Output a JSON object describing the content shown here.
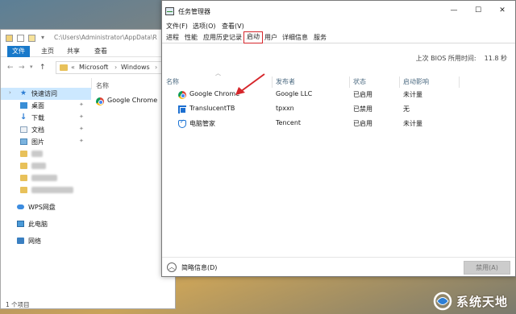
{
  "explorer": {
    "path": "C:\\Users\\Administrator\\AppData\\R",
    "ribbon_tabs": [
      "文件",
      "主页",
      "共享",
      "查看"
    ],
    "breadcrumb": [
      "«",
      "Microsoft",
      "›",
      "Windows",
      "›"
    ],
    "column_name": "名称",
    "files": [
      {
        "name": "Google Chrome",
        "icon": "chrome-icon"
      }
    ],
    "nav": [
      {
        "label": "快速访问",
        "icon": "star-icon",
        "pinned": false
      },
      {
        "label": "桌面",
        "icon": "desktop-icon",
        "pinned": true
      },
      {
        "label": "下载",
        "icon": "download-icon",
        "pinned": true
      },
      {
        "label": "文档",
        "icon": "document-icon",
        "pinned": true
      },
      {
        "label": "图片",
        "icon": "pictures-icon",
        "pinned": true
      },
      {
        "label": "",
        "icon": "folder-icon",
        "pinned": false
      },
      {
        "label": "",
        "icon": "folder-icon",
        "pinned": false
      },
      {
        "label": "",
        "icon": "folder-icon",
        "pinned": false
      },
      {
        "label": "",
        "icon": "folder-icon",
        "pinned": false
      },
      {
        "label": "WPS网盘",
        "icon": "cloud-icon",
        "pinned": false
      },
      {
        "label": "此电脑",
        "icon": "computer-icon",
        "pinned": false
      },
      {
        "label": "网络",
        "icon": "network-icon",
        "pinned": false
      }
    ],
    "status": "1 个项目"
  },
  "taskmgr": {
    "title": "任务管理器",
    "window_buttons": {
      "minimize": "—",
      "maximize": "☐",
      "close": "✕"
    },
    "menus": [
      "文件(F)",
      "选项(O)",
      "查看(V)"
    ],
    "tabs": [
      "进程",
      "性能",
      "应用历史记录",
      "启动",
      "用户",
      "详细信息",
      "服务"
    ],
    "active_tab": "启动",
    "bios_label": "上次 BIOS 所用时间:",
    "bios_value": "11.8 秒",
    "columns": [
      "名称",
      "发布者",
      "状态",
      "启动影响"
    ],
    "rows": [
      {
        "name": "Google Chrome",
        "publisher": "Google LLC",
        "status": "已启用",
        "impact": "未计量",
        "icon": "chrome-icon"
      },
      {
        "name": "TranslucentTB",
        "publisher": "tpxxn",
        "status": "已禁用",
        "impact": "无",
        "icon": "translucenttb-icon"
      },
      {
        "name": "电脑管家",
        "publisher": "Tencent",
        "status": "已启用",
        "impact": "未计量",
        "icon": "tencent-pc-manager-icon"
      }
    ],
    "fewer_details": "简略信息(D)",
    "disable_button": "禁用(A)"
  },
  "watermark": {
    "text": "系统天地"
  },
  "colors": {
    "accent": "#1979ca",
    "highlight": "#d6262b",
    "selected": "#cce8ff"
  }
}
